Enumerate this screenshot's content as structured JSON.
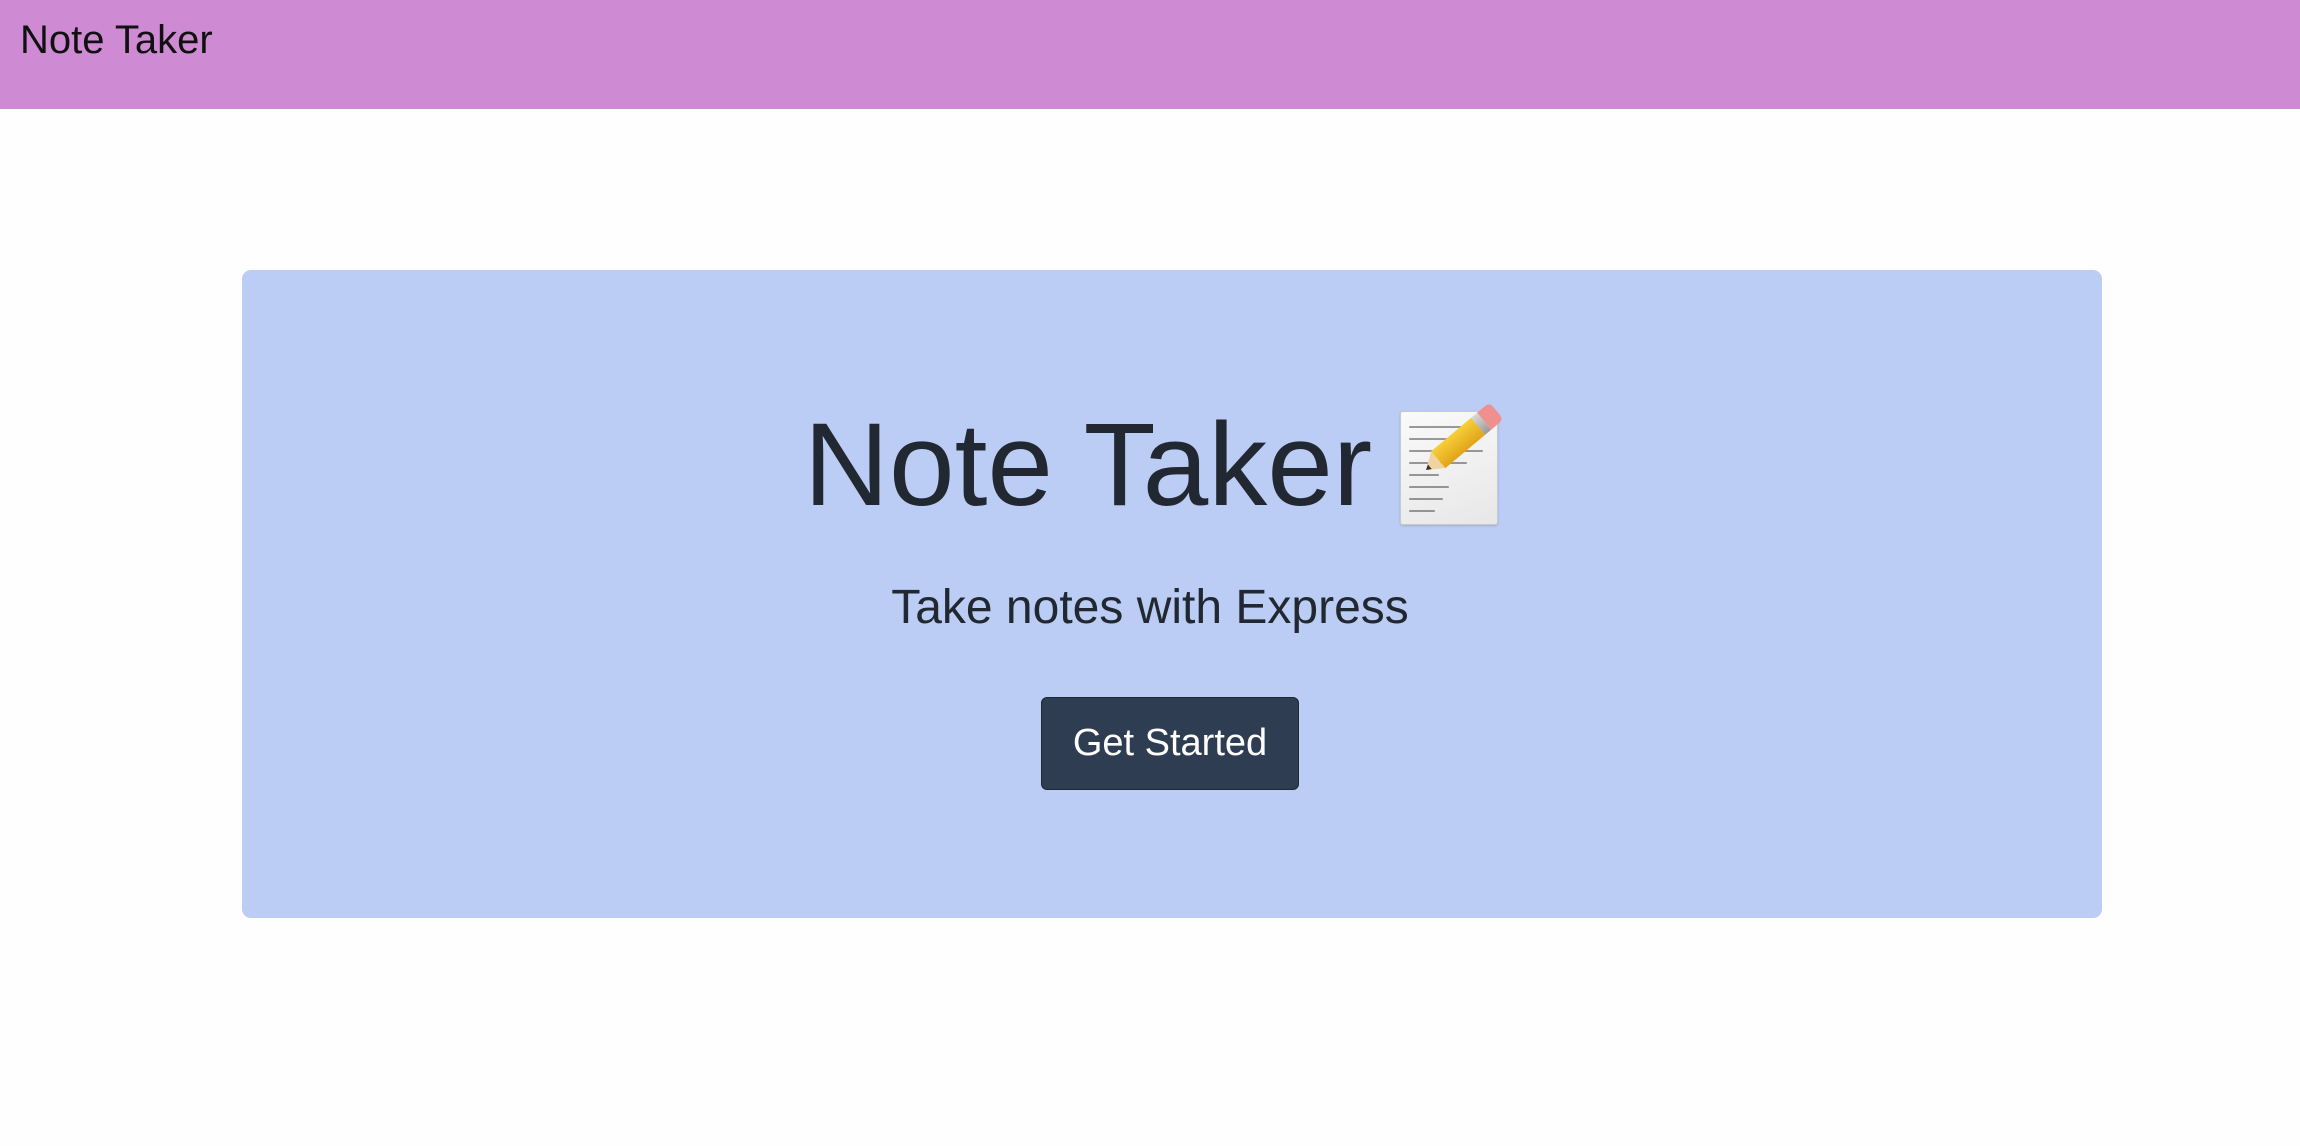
{
  "navbar": {
    "brand": "Note Taker",
    "background": "#cf8ad4"
  },
  "hero": {
    "title": "Note Taker",
    "title_icon": "memo-pencil-icon",
    "subtitle": "Take notes with Express",
    "button_label": "Get Started",
    "background": "#bbcdf4",
    "button_color": "#2e3d51"
  }
}
